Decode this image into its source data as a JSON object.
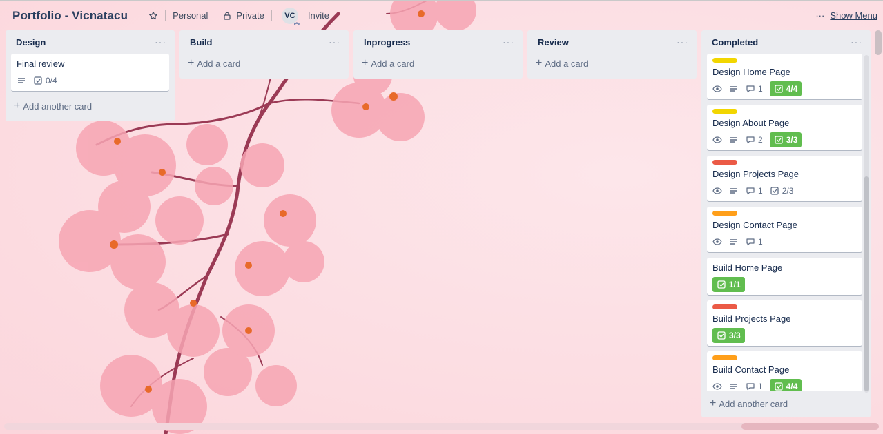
{
  "header": {
    "title": "Portfolio - Vicnatacu",
    "team": "Personal",
    "visibility": "Private",
    "avatar_initials": "VC",
    "invite": "Invite",
    "more": "···",
    "show_menu": "Show Menu"
  },
  "lists": [
    {
      "title": "Design",
      "more": "···",
      "add_label": "Add another card",
      "cards": [
        {
          "title": "Final review",
          "checklist": "0/4"
        }
      ]
    },
    {
      "title": "Build",
      "more": "···",
      "add_label": "Add a card"
    },
    {
      "title": "Inprogress",
      "more": "···",
      "add_label": "Add a card"
    },
    {
      "title": "Review",
      "more": "···",
      "add_label": "Add a card"
    },
    {
      "title": "Completed",
      "more": "···",
      "add_label": "Add another card",
      "cards": [
        {
          "title": "Design Home Page",
          "label_color": "#f2d600",
          "comments": "1",
          "checklist": "4/4"
        },
        {
          "title": "Design About Page",
          "label_color": "#f2d600",
          "comments": "2",
          "checklist": "3/3"
        },
        {
          "title": "Design Projects Page",
          "label_color": "#eb5a46",
          "comments": "1",
          "checklist": "2/3"
        },
        {
          "title": "Design Contact Page",
          "label_color": "#ff9f1a",
          "comments": "1"
        },
        {
          "title": "Build Home Page",
          "checklist": "1/1"
        },
        {
          "title": "Build Projects Page",
          "label_color": "#eb5a46",
          "checklist": "3/3"
        },
        {
          "title": "Build Contact Page",
          "label_color": "#ff9f1a",
          "comments": "1",
          "checklist": "4/4"
        }
      ]
    }
  ],
  "colors": {
    "complete_badge": "#61bd4f",
    "list_bg": "#ebecf0",
    "board_bg": "#fddfe4"
  }
}
